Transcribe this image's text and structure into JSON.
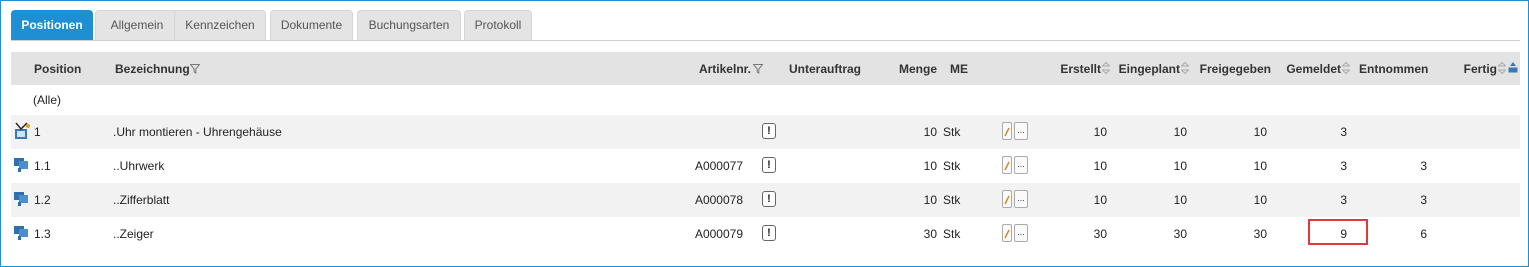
{
  "tabs": [
    {
      "label": "Positionen",
      "active": true
    },
    {
      "label": "Allgemein"
    },
    {
      "label": "Kennzeichen"
    },
    {
      "label": "Dokumente"
    },
    {
      "label": "Buchungsarten"
    },
    {
      "label": "Protokoll"
    }
  ],
  "columns": {
    "position": "Position",
    "bezeichnung": "Bezeichnung",
    "artikelnr": "Artikelnr.",
    "unterauftrag": "Unterauftrag",
    "menge": "Menge",
    "me": "ME",
    "erstellt": "Erstellt",
    "eingeplant": "Eingeplant",
    "freigegeben": "Freigegeben",
    "gemeldet": "Gemeldet",
    "entnommen": "Entnommen",
    "fertig": "Fertig"
  },
  "filter_text": "(Alle)",
  "rows": [
    {
      "position": "1",
      "bezeichnung": ".Uhr montieren - Uhrengehäuse",
      "artikelnr": "",
      "info": "!",
      "menge": "10",
      "me": "Stk",
      "erstellt": "10",
      "eingeplant": "10",
      "freigegeben": "10",
      "gemeldet": "3",
      "entnommen": "",
      "fertig": "",
      "icon": "assembly-icon"
    },
    {
      "position": "1.1",
      "bezeichnung": "..Uhrwerk",
      "artikelnr": "A000077",
      "info": "!",
      "menge": "10",
      "me": "Stk",
      "erstellt": "10",
      "eingeplant": "10",
      "freigegeben": "10",
      "gemeldet": "3",
      "entnommen": "3",
      "fertig": "",
      "icon": "material-icon"
    },
    {
      "position": "1.2",
      "bezeichnung": "..Zifferblatt",
      "artikelnr": "A000078",
      "info": "!",
      "menge": "10",
      "me": "Stk",
      "erstellt": "10",
      "eingeplant": "10",
      "freigegeben": "10",
      "gemeldet": "3",
      "entnommen": "3",
      "fertig": "",
      "icon": "material-icon"
    },
    {
      "position": "1.3",
      "bezeichnung": "..Zeiger",
      "artikelnr": "A000079",
      "info": "!",
      "menge": "30",
      "me": "Stk",
      "erstellt": "30",
      "eingeplant": "30",
      "freigegeben": "30",
      "gemeldet": "9",
      "entnommen": "6",
      "fertig": "",
      "icon": "material-icon",
      "gemeldet_highlighted": true
    }
  ],
  "dots_label": "...",
  "colors": {
    "accent": "#1e8fd2",
    "highlight": "#e23a3a",
    "header_bg": "#e3e3e3"
  }
}
